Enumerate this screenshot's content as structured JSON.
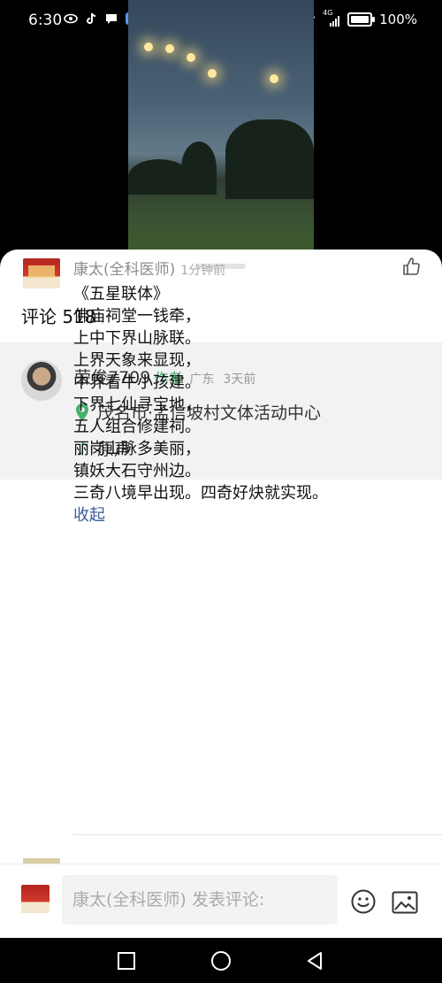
{
  "status_bar": {
    "time": "6:30",
    "network": "4G",
    "battery": "100%"
  },
  "comments": {
    "title": "评论 518"
  },
  "author": {
    "name": "荣俊7709",
    "badge": "作者",
    "region": "广东",
    "time": "3天前",
    "location": "茂名市·孟信坡村文体活动中心",
    "music": "原声"
  },
  "comment": {
    "user": "康太(全科医师)",
    "time": "1分钟前",
    "lines": [
      "《五星联体》",
      "佛庙祠堂一钱牵，",
      "上中下界山脉联。",
      "上界天象来显现，",
      "中界看牛小孩建。",
      "下界七仙寻宝地，",
      "五人组合修建祠。",
      "丽岗山脉多美丽，",
      "镇妖大石守州边。",
      "三奇八境早出现。四奇好炔就实现。"
    ],
    "collapse": "收起"
  },
  "input": {
    "placeholder": "康太(全科医师) 发表评论:"
  },
  "colors": {
    "accent_green": "#46b06b",
    "link_blue": "#3b5a97"
  }
}
